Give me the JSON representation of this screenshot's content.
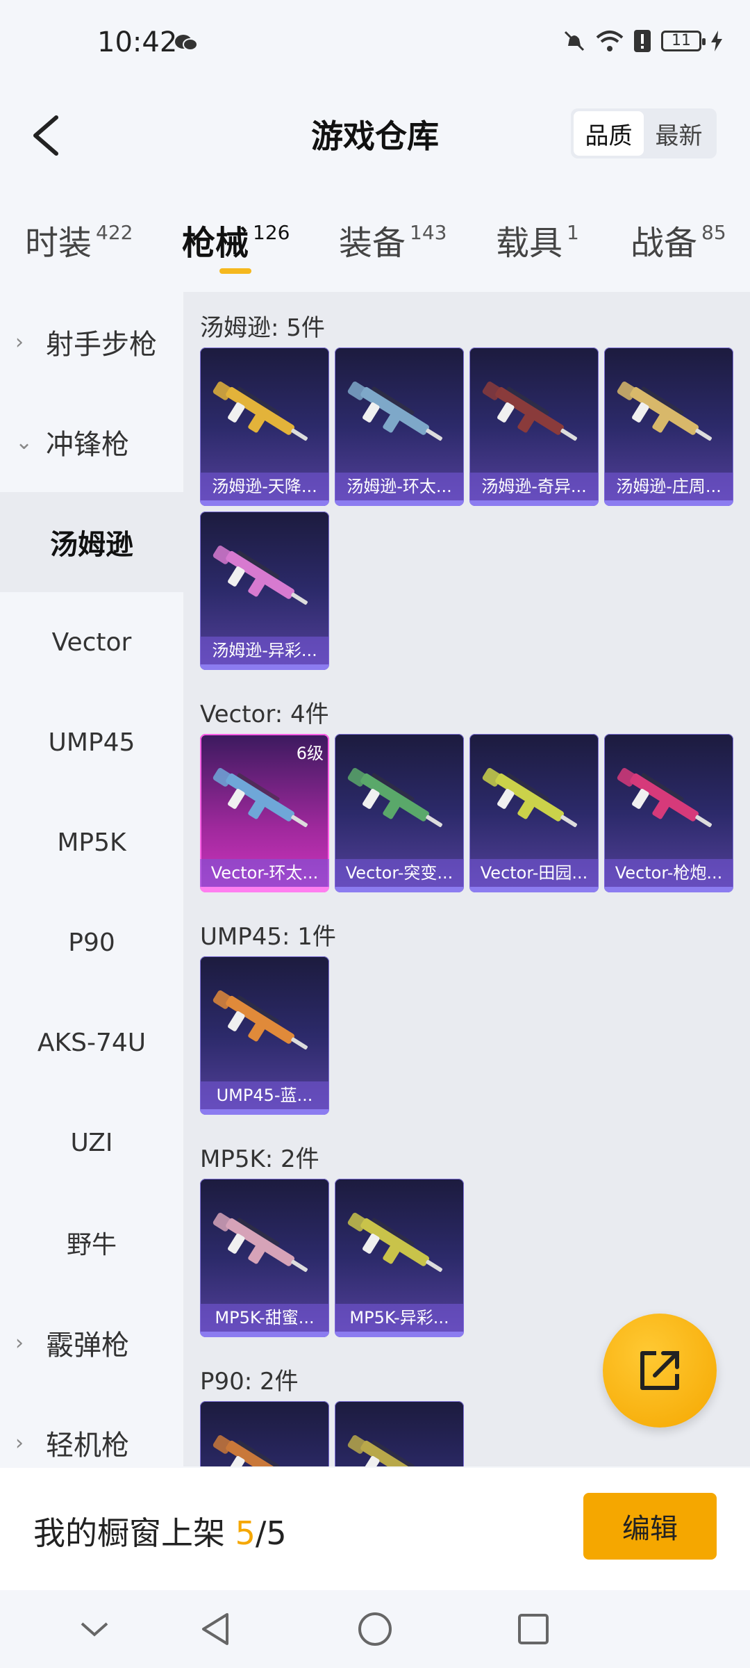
{
  "status": {
    "time": "10:42",
    "battery": "11"
  },
  "header": {
    "title": "游戏仓库",
    "sort": [
      "品质",
      "最新"
    ]
  },
  "tabs": [
    {
      "label": "时装",
      "count": "422"
    },
    {
      "label": "枪械",
      "count": "126"
    },
    {
      "label": "装备",
      "count": "143"
    },
    {
      "label": "载具",
      "count": "1"
    },
    {
      "label": "战备",
      "count": "85"
    }
  ],
  "sidebar": [
    {
      "label": "射手步枪",
      "type": "group",
      "chev": "›"
    },
    {
      "label": "冲锋枪",
      "type": "group",
      "chev": "⌄"
    },
    {
      "label": "汤姆逊",
      "type": "sub",
      "selected": true
    },
    {
      "label": "Vector",
      "type": "sub"
    },
    {
      "label": "UMP45",
      "type": "sub"
    },
    {
      "label": "MP5K",
      "type": "sub"
    },
    {
      "label": "P90",
      "type": "sub"
    },
    {
      "label": "AKS-74U",
      "type": "sub"
    },
    {
      "label": "UZI",
      "type": "sub"
    },
    {
      "label": "野牛",
      "type": "sub"
    },
    {
      "label": "霰弹枪",
      "type": "group",
      "chev": "›"
    },
    {
      "label": "轻机枪",
      "type": "group",
      "chev": "›"
    }
  ],
  "sections": [
    {
      "title": "汤姆逊: 5件",
      "items": [
        {
          "name": "汤姆逊-天降...",
          "color": "#e3b33a"
        },
        {
          "name": "汤姆逊-环太...",
          "color": "#7ea8c9"
        },
        {
          "name": "汤姆逊-奇异...",
          "color": "#8a3b3b"
        },
        {
          "name": "汤姆逊-庄周...",
          "color": "#d8b86a"
        },
        {
          "name": "汤姆逊-异彩...",
          "color": "#d77ad0"
        }
      ]
    },
    {
      "title": "Vector: 4件",
      "items": [
        {
          "name": "Vector-环太...",
          "color": "#6fa7d8",
          "level": "6级",
          "highlight": true
        },
        {
          "name": "Vector-突变...",
          "color": "#5aa86a"
        },
        {
          "name": "Vector-田园...",
          "color": "#cbd24a"
        },
        {
          "name": "Vector-枪炮...",
          "color": "#d63a7a"
        }
      ]
    },
    {
      "title": "UMP45: 1件",
      "items": [
        {
          "name": "UMP45-蓝...",
          "color": "#e08a3a"
        }
      ]
    },
    {
      "title": "MP5K: 2件",
      "items": [
        {
          "name": "MP5K-甜蜜...",
          "color": "#d6a3b8"
        },
        {
          "name": "MP5K-异彩...",
          "color": "#c9c34a"
        }
      ]
    },
    {
      "title": "P90: 2件",
      "items": [
        {
          "name": "",
          "color": "#c9783a"
        },
        {
          "name": "",
          "color": "#b8a84a"
        }
      ]
    }
  ],
  "shelf": {
    "label": "我的橱窗上架",
    "current": "5",
    "total": "/5",
    "edit": "编辑"
  }
}
